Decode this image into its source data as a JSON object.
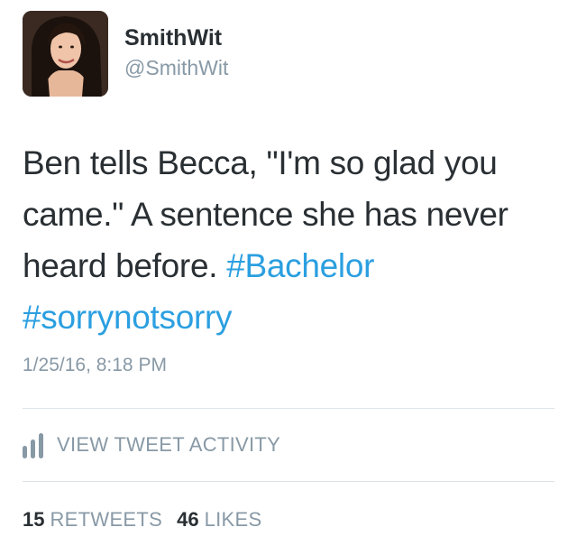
{
  "user": {
    "display_name": "SmithWit",
    "handle": "@SmithWit",
    "avatar_icon": "profile-photo"
  },
  "tweet": {
    "text": "Ben tells Becca, \"I'm so glad you came.\" A sentence she has never heard before.",
    "hashtags": [
      "#Bachelor",
      "#sorrynotsorry"
    ],
    "timestamp": "1/25/16, 8:18 PM"
  },
  "activity": {
    "label": "VIEW TWEET ACTIVITY",
    "icon": "bar-chart-icon"
  },
  "stats": {
    "retweets_count": "15",
    "retweets_label": "RETWEETS",
    "likes_count": "46",
    "likes_label": "LIKES"
  },
  "colors": {
    "text": "#292f33",
    "muted": "#8899a6",
    "link": "#2b9fe0",
    "divider": "#dde3e8"
  }
}
